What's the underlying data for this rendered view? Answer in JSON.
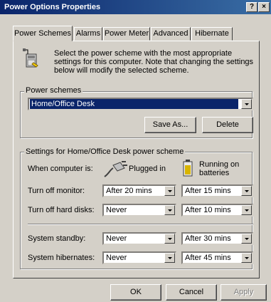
{
  "window": {
    "title": "Power Options Properties",
    "help": "?",
    "close": "×"
  },
  "tabs": [
    {
      "label": "Power Schemes"
    },
    {
      "label": "Alarms"
    },
    {
      "label": "Power Meter"
    },
    {
      "label": "Advanced"
    },
    {
      "label": "Hibernate"
    }
  ],
  "intro": {
    "icon": "power-scheme-icon",
    "text": "Select the power scheme with the most appropriate settings for this computer. Note that changing the settings below will modify the selected scheme."
  },
  "schemes": {
    "legend": "Power schemes",
    "selected": "Home/Office Desk",
    "save_as": "Save As...",
    "delete": "Delete"
  },
  "settings": {
    "legend": "Settings for Home/Office Desk power scheme",
    "when_label": "When computer is:",
    "plugged_in": "Plugged in",
    "plugged_icon": "power-plug-icon",
    "batteries": "Running on batteries",
    "battery_icon": "battery-icon",
    "rows": [
      {
        "label": "Turn off monitor:",
        "plugged": "After 20 mins",
        "battery": "After 15 mins"
      },
      {
        "label": "Turn off hard disks:",
        "plugged": "Never",
        "battery": "After 10 mins"
      },
      {
        "label": "System standby:",
        "plugged": "Never",
        "battery": "After 30 mins"
      },
      {
        "label": "System hibernates:",
        "plugged": "Never",
        "battery": "After 45 mins"
      }
    ]
  },
  "footer": {
    "ok": "OK",
    "cancel": "Cancel",
    "apply": "Apply"
  }
}
